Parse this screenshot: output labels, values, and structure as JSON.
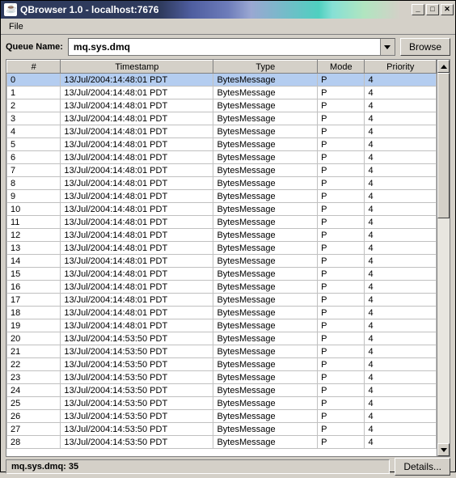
{
  "window": {
    "title": "QBrowser 1.0 - localhost:7676"
  },
  "menu": {
    "file": "File"
  },
  "toolbar": {
    "queue_label": "Queue Name:",
    "queue_value": "mq.sys.dmq",
    "browse_label": "Browse"
  },
  "columns": [
    "#",
    "Timestamp",
    "Type",
    "Mode",
    "Priority"
  ],
  "rows": [
    {
      "n": "0",
      "ts": "13/Jul/2004:14:48:01 PDT",
      "type": "BytesMessage",
      "mode": "P",
      "pri": "4",
      "selected": true
    },
    {
      "n": "1",
      "ts": "13/Jul/2004:14:48:01 PDT",
      "type": "BytesMessage",
      "mode": "P",
      "pri": "4"
    },
    {
      "n": "2",
      "ts": "13/Jul/2004:14:48:01 PDT",
      "type": "BytesMessage",
      "mode": "P",
      "pri": "4"
    },
    {
      "n": "3",
      "ts": "13/Jul/2004:14:48:01 PDT",
      "type": "BytesMessage",
      "mode": "P",
      "pri": "4"
    },
    {
      "n": "4",
      "ts": "13/Jul/2004:14:48:01 PDT",
      "type": "BytesMessage",
      "mode": "P",
      "pri": "4"
    },
    {
      "n": "5",
      "ts": "13/Jul/2004:14:48:01 PDT",
      "type": "BytesMessage",
      "mode": "P",
      "pri": "4"
    },
    {
      "n": "6",
      "ts": "13/Jul/2004:14:48:01 PDT",
      "type": "BytesMessage",
      "mode": "P",
      "pri": "4"
    },
    {
      "n": "7",
      "ts": "13/Jul/2004:14:48:01 PDT",
      "type": "BytesMessage",
      "mode": "P",
      "pri": "4"
    },
    {
      "n": "8",
      "ts": "13/Jul/2004:14:48:01 PDT",
      "type": "BytesMessage",
      "mode": "P",
      "pri": "4"
    },
    {
      "n": "9",
      "ts": "13/Jul/2004:14:48:01 PDT",
      "type": "BytesMessage",
      "mode": "P",
      "pri": "4"
    },
    {
      "n": "10",
      "ts": "13/Jul/2004:14:48:01 PDT",
      "type": "BytesMessage",
      "mode": "P",
      "pri": "4"
    },
    {
      "n": "11",
      "ts": "13/Jul/2004:14:48:01 PDT",
      "type": "BytesMessage",
      "mode": "P",
      "pri": "4"
    },
    {
      "n": "12",
      "ts": "13/Jul/2004:14:48:01 PDT",
      "type": "BytesMessage",
      "mode": "P",
      "pri": "4"
    },
    {
      "n": "13",
      "ts": "13/Jul/2004:14:48:01 PDT",
      "type": "BytesMessage",
      "mode": "P",
      "pri": "4"
    },
    {
      "n": "14",
      "ts": "13/Jul/2004:14:48:01 PDT",
      "type": "BytesMessage",
      "mode": "P",
      "pri": "4"
    },
    {
      "n": "15",
      "ts": "13/Jul/2004:14:48:01 PDT",
      "type": "BytesMessage",
      "mode": "P",
      "pri": "4"
    },
    {
      "n": "16",
      "ts": "13/Jul/2004:14:48:01 PDT",
      "type": "BytesMessage",
      "mode": "P",
      "pri": "4"
    },
    {
      "n": "17",
      "ts": "13/Jul/2004:14:48:01 PDT",
      "type": "BytesMessage",
      "mode": "P",
      "pri": "4"
    },
    {
      "n": "18",
      "ts": "13/Jul/2004:14:48:01 PDT",
      "type": "BytesMessage",
      "mode": "P",
      "pri": "4"
    },
    {
      "n": "19",
      "ts": "13/Jul/2004:14:48:01 PDT",
      "type": "BytesMessage",
      "mode": "P",
      "pri": "4"
    },
    {
      "n": "20",
      "ts": "13/Jul/2004:14:53:50 PDT",
      "type": "BytesMessage",
      "mode": "P",
      "pri": "4"
    },
    {
      "n": "21",
      "ts": "13/Jul/2004:14:53:50 PDT",
      "type": "BytesMessage",
      "mode": "P",
      "pri": "4"
    },
    {
      "n": "22",
      "ts": "13/Jul/2004:14:53:50 PDT",
      "type": "BytesMessage",
      "mode": "P",
      "pri": "4"
    },
    {
      "n": "23",
      "ts": "13/Jul/2004:14:53:50 PDT",
      "type": "BytesMessage",
      "mode": "P",
      "pri": "4"
    },
    {
      "n": "24",
      "ts": "13/Jul/2004:14:53:50 PDT",
      "type": "BytesMessage",
      "mode": "P",
      "pri": "4"
    },
    {
      "n": "25",
      "ts": "13/Jul/2004:14:53:50 PDT",
      "type": "BytesMessage",
      "mode": "P",
      "pri": "4"
    },
    {
      "n": "26",
      "ts": "13/Jul/2004:14:53:50 PDT",
      "type": "BytesMessage",
      "mode": "P",
      "pri": "4"
    },
    {
      "n": "27",
      "ts": "13/Jul/2004:14:53:50 PDT",
      "type": "BytesMessage",
      "mode": "P",
      "pri": "4"
    },
    {
      "n": "28",
      "ts": "13/Jul/2004:14:53:50 PDT",
      "type": "BytesMessage",
      "mode": "P",
      "pri": "4"
    }
  ],
  "status": {
    "text": "mq.sys.dmq: 35",
    "details_label": "Details..."
  }
}
